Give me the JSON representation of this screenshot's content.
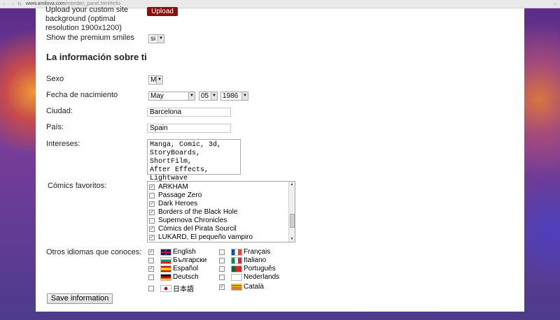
{
  "browser": {
    "url_main": "www.amilova.com",
    "url_rest": "/member_panel.html#info"
  },
  "upload": {
    "label": "Upload your custom site background (optimal resolution 1900x1200)",
    "button": "Upload"
  },
  "premium": {
    "label": "Show the premium smiles",
    "value": "si"
  },
  "section_title": "La información sobre ti",
  "sexo": {
    "label": "Sexo",
    "value": "M"
  },
  "fecha": {
    "label": "Fecha de nacimiento",
    "month": "May",
    "day": "05",
    "year": "1986"
  },
  "ciudad": {
    "label": "Ciudad:",
    "value": "Barcelona"
  },
  "pais": {
    "label": "País:",
    "value": "Spain"
  },
  "intereses": {
    "label": "Intereses:",
    "value": "Manga, Comic, 3d,\nStoryBoards, ShortFilm,\nAfter Effects, Lightwave"
  },
  "comics": {
    "label": "Cómics favoritos:",
    "items": [
      {
        "name": "ARKHAM",
        "checked": true
      },
      {
        "name": "Passage Zero",
        "checked": false
      },
      {
        "name": "Dark Heroes",
        "checked": true
      },
      {
        "name": "Borders of the Black Hole",
        "checked": true
      },
      {
        "name": "Supernova Chronicles",
        "checked": false
      },
      {
        "name": "Cómics del Pirata Sourcil",
        "checked": true
      },
      {
        "name": "LUKARD, El pequeño vampiro",
        "checked": true
      }
    ]
  },
  "idiomas": {
    "label": "Otros idiomas que conoces:",
    "items": [
      {
        "name": "English",
        "checked": true,
        "flag": "uk-flag-icon"
      },
      {
        "name": "Français",
        "checked": false,
        "flag": "france-flag-icon"
      },
      {
        "name": "Български",
        "checked": false,
        "flag": "bulgaria-flag-icon"
      },
      {
        "name": "Italiano",
        "checked": false,
        "flag": "italy-flag-icon"
      },
      {
        "name": "Español",
        "checked": true,
        "flag": "spain-flag-icon"
      },
      {
        "name": "Português",
        "checked": false,
        "flag": "portugal-flag-icon"
      },
      {
        "name": "Deutsch",
        "checked": false,
        "flag": "germany-flag-icon"
      },
      {
        "name": "Nederlands",
        "checked": false,
        "flag": "netherlands-flag-icon"
      },
      {
        "name": "日本語",
        "checked": false,
        "flag": "japan-flag-icon"
      },
      {
        "name": "Català",
        "checked": true,
        "flag": "catalonia-flag-icon"
      }
    ]
  },
  "save_button": "Save information",
  "colors": {
    "upload_button": "#8b0d0d",
    "page_background": "#6a3f8c"
  }
}
